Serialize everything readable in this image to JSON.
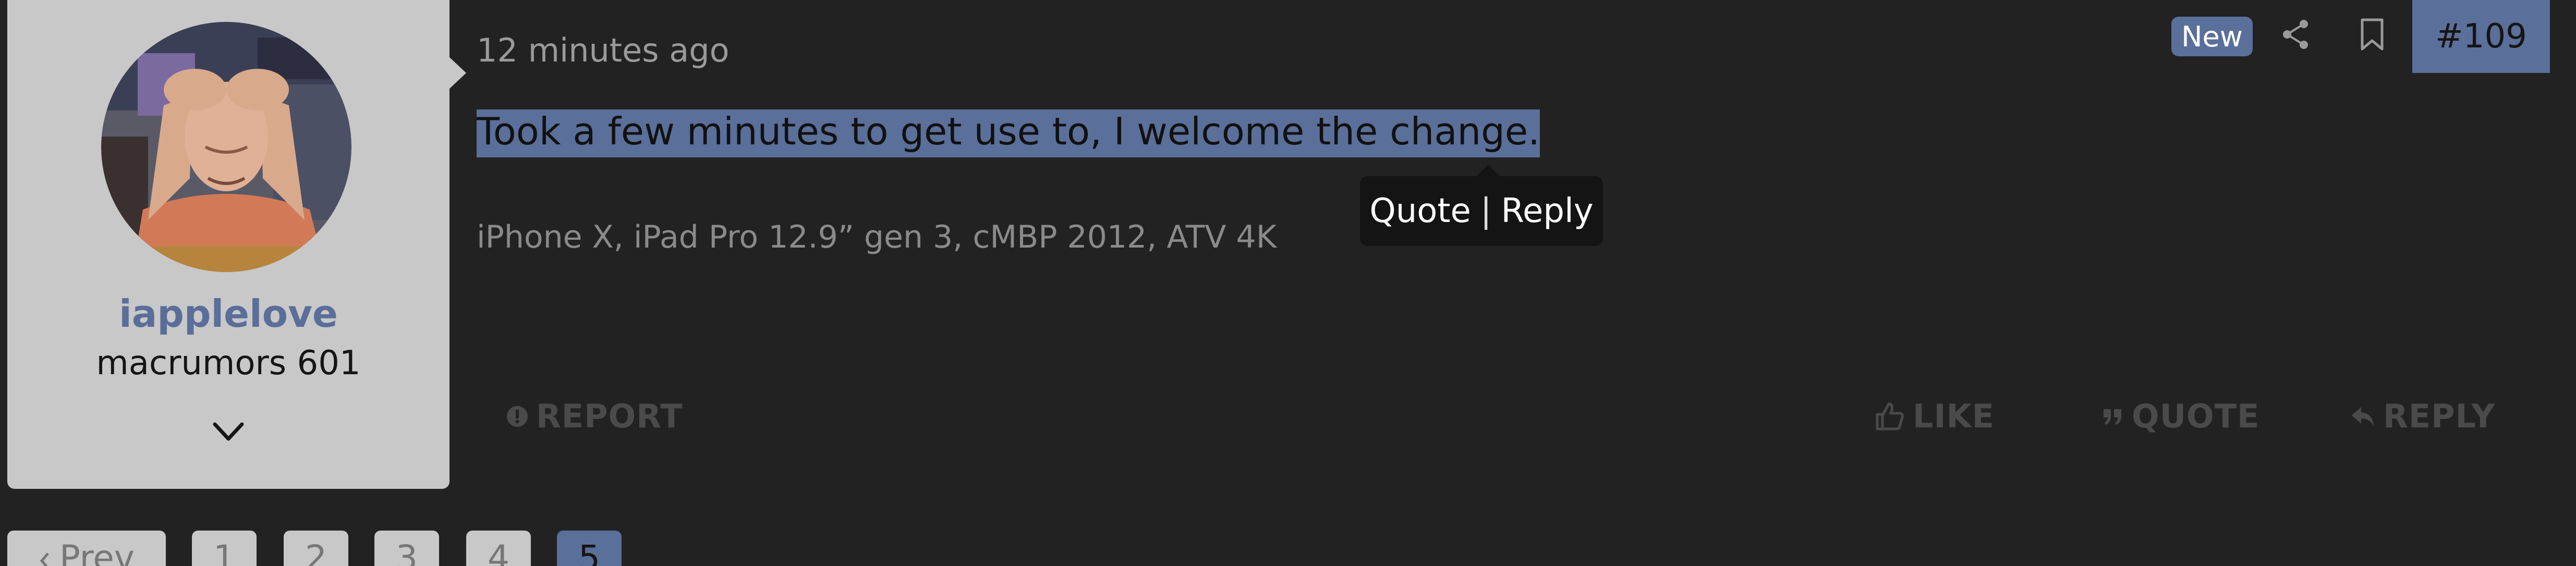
{
  "user": {
    "username": "iapplelove",
    "title": "macrumors 601"
  },
  "post": {
    "time": "12 minutes ago",
    "text": "Took a few minutes to get use to, I welcome the change.",
    "signature": "iPhone X, iPad Pro 12.9” gen 3, cMBP 2012, ATV 4K",
    "badge": "New",
    "number": "#109"
  },
  "tooltip": {
    "quote": "Quote",
    "separator": "|",
    "reply": "Reply"
  },
  "actions": {
    "report": "REPORT",
    "like": "LIKE",
    "quote": "QUOTE",
    "reply": "REPLY"
  },
  "pagination": {
    "prev": "Prev",
    "pages": [
      "1",
      "2",
      "3",
      "4",
      "5"
    ],
    "current": "5"
  },
  "colors": {
    "background": "#222222",
    "panel": "#c8c8c8",
    "accent": "#5a6f99",
    "username": "#5b6e9a"
  },
  "icons": {
    "share": "share-icon",
    "bookmark": "bookmark-icon",
    "report": "exclamation-circle-icon",
    "like": "thumbs-up-icon",
    "quote": "quote-marks-icon",
    "reply": "reply-arrow-icon",
    "expand": "chevron-down-icon",
    "prev": "chevron-left-icon"
  }
}
